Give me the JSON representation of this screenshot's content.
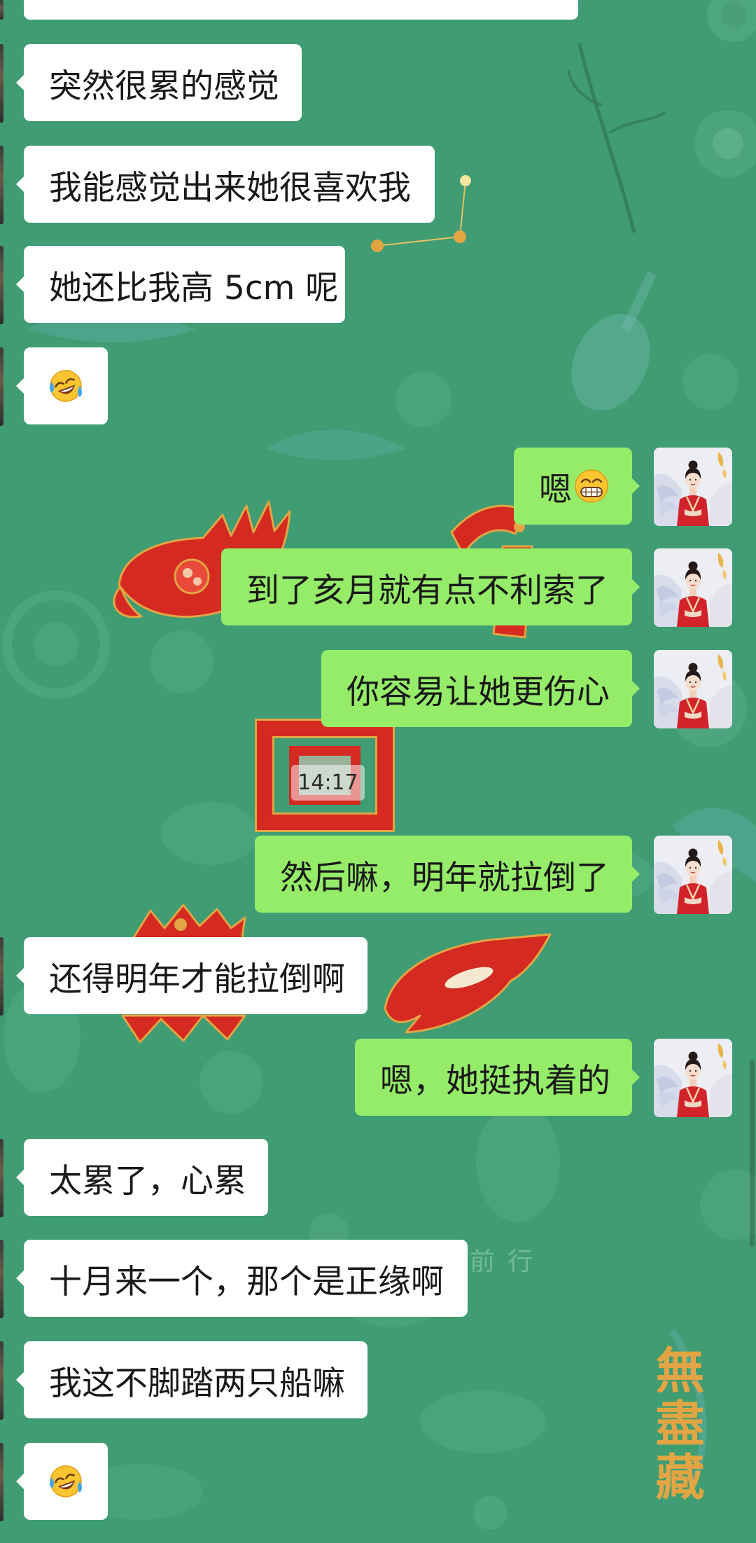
{
  "theme": {
    "background": "#3f9c73",
    "incoming_bubble": "#ffffff",
    "outgoing_bubble": "#95ec69",
    "text": "#191919",
    "art_red": "#d42a22",
    "art_gold": "#e3a543"
  },
  "outgoing_avatar_icon": "woman-in-red-hanfu-avatar",
  "messages": [
    {
      "direction": "incoming"
    },
    {
      "direction": "incoming",
      "text": "突然很累的感觉"
    },
    {
      "direction": "incoming",
      "text": "我能感觉出来她很喜欢我"
    },
    {
      "direction": "incoming",
      "text": "她还比我高 5cm 呢"
    },
    {
      "direction": "incoming",
      "emoji_icon": "tears-of-joy-emoji"
    },
    {
      "direction": "outgoing",
      "text": "嗯",
      "emoji_icon": "grin-emoji"
    },
    {
      "direction": "outgoing",
      "text": "到了亥月就有点不利索了"
    },
    {
      "direction": "outgoing",
      "text": "你容易让她更伤心"
    },
    {
      "type": "timestamp",
      "text": "14:17"
    },
    {
      "direction": "outgoing",
      "text": "然后嘛，明年就拉倒了"
    },
    {
      "direction": "incoming",
      "text": "还得明年才能拉倒啊"
    },
    {
      "direction": "outgoing",
      "text": "嗯，她挺执着的"
    },
    {
      "direction": "incoming",
      "text": "太累了，心累"
    },
    {
      "direction": "incoming",
      "text": "十月来一个，那个是正缘啊"
    },
    {
      "direction": "incoming",
      "text": "我这不脚踏两只船嘛"
    },
    {
      "direction": "incoming",
      "emoji_icon": "tears-of-joy-emoji"
    }
  ],
  "background_art": {
    "calligraphy": "無盡藏",
    "faint_text": "前行"
  }
}
